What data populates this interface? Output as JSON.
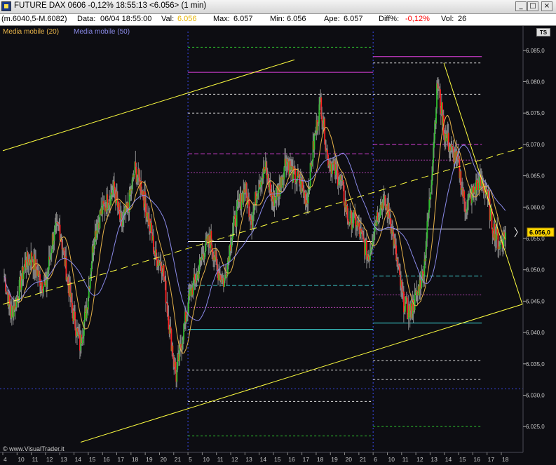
{
  "window": {
    "title": "FUTURE DAX 0606 -0,12% 18:55:13 <6.056> (1 min)",
    "minimize": "_",
    "maximize": "□",
    "close": "×"
  },
  "infobar": {
    "range": "(m.6040,5-M.6082)",
    "data_label": "Data:",
    "data_value": "06/04 18:55:00",
    "val_label": "Val:",
    "val_value": "6.056",
    "max_label": "Max:",
    "max_value": "6.057",
    "min_label": "Min:",
    "min_value": "6.056",
    "ape_label": "Ape:",
    "ape_value": "6.057",
    "diff_label": "Diff%:",
    "diff_value": "-0,12%",
    "vol_label": "Vol:",
    "vol_value": "26"
  },
  "legend": {
    "ma20": "Media mobile (20)",
    "ma50": "Media mobile (50)"
  },
  "ts_button": "TS",
  "watermark": "© www.VisualTrader.it",
  "colors": {
    "ma20": "#e8b44a",
    "ma50": "#8a8ae8",
    "up": "#2ec02e",
    "down": "#ff2020",
    "wick": "#8a8a8a",
    "trend": "#ffff40",
    "price_tag": "#ffd700"
  },
  "chart_data": {
    "type": "candlestick",
    "instrument": "FUTURE DAX 0606",
    "interval": "1 min",
    "last_price": "6.056,0",
    "ylim": [
      6022,
      6088
    ],
    "y_ticks": [
      "6.085,0",
      "6.080,0",
      "6.075,0",
      "6.070,0",
      "6.065,0",
      "6.060,0",
      "6.055,0",
      "6.050,0",
      "6.045,0",
      "6.040,0",
      "6.035,0",
      "6.030,0",
      "6.025,0"
    ],
    "x_ticks": [
      "4",
      "10",
      "11",
      "12",
      "13",
      "14",
      "15",
      "16",
      "17",
      "18",
      "19",
      "20",
      "21",
      "5",
      "10",
      "11",
      "12",
      "13",
      "14",
      "15",
      "16",
      "17",
      "18",
      "19",
      "20",
      "21",
      "6",
      "10",
      "11",
      "12",
      "13",
      "14",
      "15",
      "16",
      "17",
      "18"
    ],
    "day_separators": [
      "5",
      "6"
    ],
    "close_path": [
      6049,
      6043,
      6046,
      6051,
      6052,
      6049,
      6047,
      6055,
      6057,
      6050,
      6043,
      6038,
      6044,
      6055,
      6059,
      6061,
      6063,
      6057,
      6060,
      6066,
      6063,
      6058,
      6052,
      6051,
      6041,
      6033,
      6040,
      6046,
      6049,
      6053,
      6055,
      6050,
      6048,
      6055,
      6060,
      6063,
      6058,
      6064,
      6066,
      6061,
      6063,
      6068,
      6065,
      6064,
      6061,
      6070,
      6077,
      6068,
      6066,
      6064,
      6058,
      6058,
      6055,
      6052,
      6058,
      6061,
      6059,
      6052,
      6045,
      6043,
      6046,
      6050,
      6063,
      6080,
      6072,
      6069,
      6067,
      6060,
      6062,
      6064,
      6063,
      6057,
      6054,
      6056
    ]
  }
}
